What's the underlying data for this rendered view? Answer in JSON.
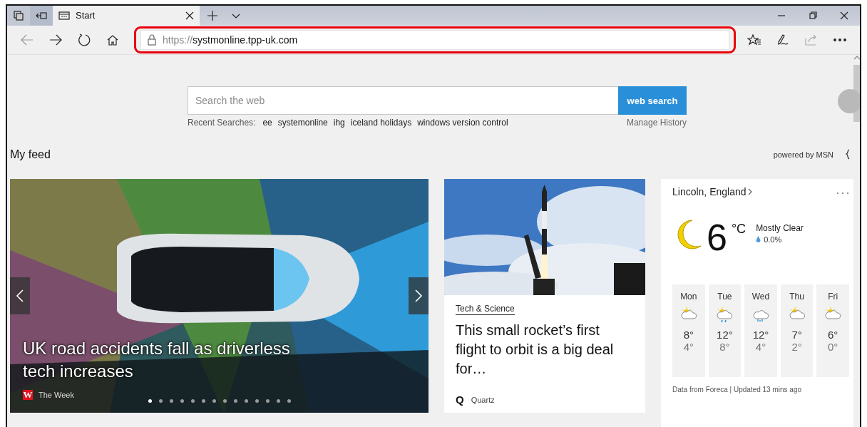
{
  "tabs": [
    {
      "title": "Start",
      "selected": true
    }
  ],
  "address_bar": {
    "scheme": "https://",
    "host": "systmonline.tpp-uk.com",
    "highlighted": true
  },
  "search": {
    "placeholder": "Search the web",
    "button": "web search",
    "recent_label": "Recent Searches:",
    "recent": [
      "ee",
      "systemonline",
      "ihg",
      "iceland holidays",
      "windows version control"
    ],
    "manage": "Manage History"
  },
  "feed": {
    "title": "My feed",
    "powered_by": "powered by MSN"
  },
  "hero": {
    "headline": "UK road accidents fall as driverless tech increases",
    "source_logo": "W",
    "source": "The Week",
    "dots": [
      {
        "selected": true
      },
      {
        "selected": false
      },
      {
        "selected": false
      },
      {
        "selected": false
      },
      {
        "selected": false
      },
      {
        "selected": false
      },
      {
        "selected": false
      },
      {
        "selected": false
      },
      {
        "selected": false
      },
      {
        "selected": false
      },
      {
        "selected": false
      },
      {
        "selected": false
      },
      {
        "selected": false
      },
      {
        "selected": false
      }
    ]
  },
  "story": {
    "category": "Tech & Science",
    "headline": "This small rocket’s first flight to orbit is a big deal for…",
    "source_logo": "Q",
    "source": "Quartz"
  },
  "weather": {
    "location": "Lincoln, England",
    "temp": "6",
    "unit": "°C",
    "condition": "Mostly Clear",
    "precip": "0.0%",
    "days": [
      {
        "day": "Mon",
        "kind": "partly_cloudy",
        "high": "8°",
        "low": "4°"
      },
      {
        "day": "Tue",
        "kind": "rain",
        "high": "12°",
        "low": "8°"
      },
      {
        "day": "Wed",
        "kind": "showers",
        "high": "12°",
        "low": "4°"
      },
      {
        "day": "Thu",
        "kind": "partly_cloudy",
        "high": "7°",
        "low": "2°"
      },
      {
        "day": "Fri",
        "kind": "partly_cloudy",
        "high": "6°",
        "low": "0°"
      }
    ],
    "footer": "Data from Foreca | Updated 13 mins ago"
  }
}
